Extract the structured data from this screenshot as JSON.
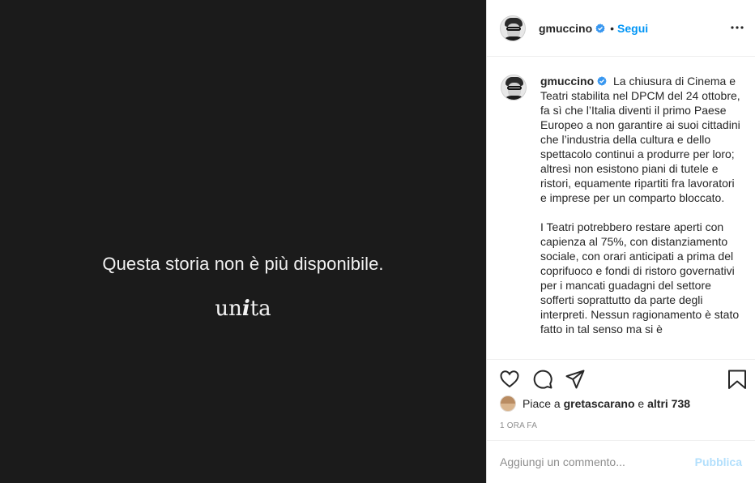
{
  "media": {
    "message": "Questa storia non è più disponibile.",
    "logo_part1": "un",
    "logo_part2": "i",
    "logo_part3": "ta"
  },
  "header": {
    "username": "gmuccino",
    "separator": "•",
    "follow_label": "Segui"
  },
  "caption": {
    "username": "gmuccino",
    "paragraph1": "La chiusura di Cinema e Teatri stabilita nel DPCM del 24 ottobre, fa sì che l’Italia diventi il primo Paese Europeo a non garantire ai suoi cittadini che l’industria della cultura e dello spettacolo continui a produrre per loro; altresì non esistono piani di tutele e ristori, equamente ripartiti fra lavoratori e imprese per un comparto bloccato.",
    "paragraph2": "I Teatri potrebbero restare aperti con capienza al 75%, con distanziamento sociale, con orari anticipati a prima del coprifuoco e fondi di ristoro governativi per i mancati guadagni del settore sofferti soprattutto da parte degli interpreti. Nessun ragionamento è stato fatto in tal senso ma si è"
  },
  "likes": {
    "prefix": "Piace a",
    "user": "gretascarano",
    "conjunction": "e",
    "others": "altri 738"
  },
  "timestamp": "1 ORA FA",
  "comment": {
    "placeholder": "Aggiungi un commento...",
    "publish_label": "Pubblica"
  },
  "colors": {
    "accent": "#0095f6",
    "publish_disabled": "#b2dffc",
    "media_bg": "#1b1b1b",
    "verified": "#3897f0"
  },
  "icons": [
    "verified-icon",
    "more-options-icon",
    "heart-icon",
    "comment-icon",
    "share-icon",
    "bookmark-icon"
  ]
}
